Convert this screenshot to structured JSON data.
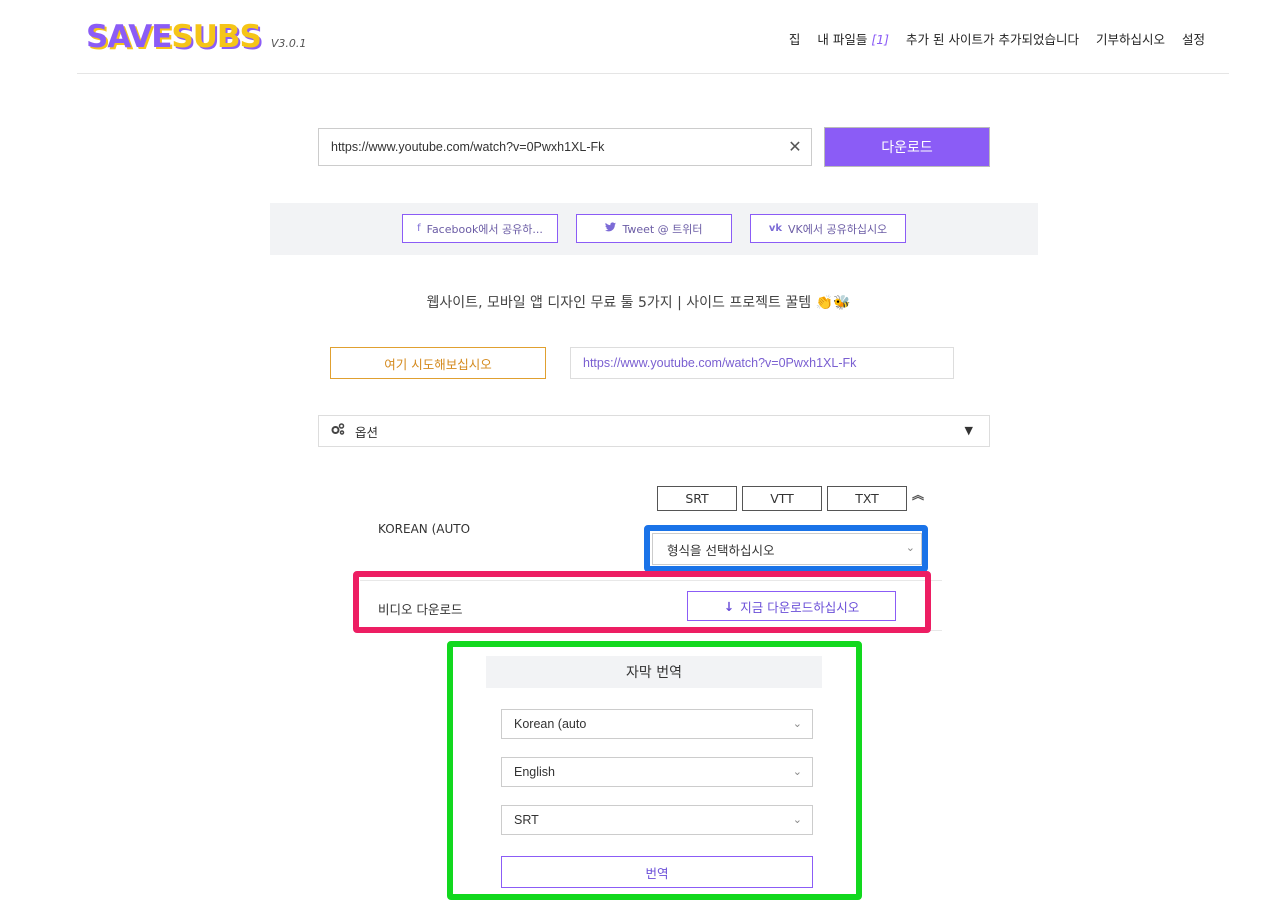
{
  "header": {
    "logo_prefix": "SAVE",
    "logo_suffix": "SUBS",
    "version": "V3.0.1",
    "nav": [
      {
        "label": "집"
      },
      {
        "label": "내 파일들",
        "count": "[1]"
      },
      {
        "label": "추가 된 사이트가 추가되었습니다"
      },
      {
        "label": "기부하십시오"
      },
      {
        "label": "설정"
      }
    ]
  },
  "search": {
    "url_value": "https://www.youtube.com/watch?v=0Pwxh1XL-Fk",
    "clear_glyph": "✕",
    "download_label": "다운로드"
  },
  "share": {
    "facebook": "Facebook에서 공유하...",
    "twitter": "Tweet @ 트위터",
    "vk": "VK에서 공유하십시오"
  },
  "tagline": "웹사이트, 모바일 앱 디자인 무료 툴 5가지 | 사이드 프로젝트 꿀템 👏🐝",
  "try": {
    "button_label": "여기 시도해보십시오",
    "example_url": "https://www.youtube.com/watch?v=0Pwxh1XL-Fk"
  },
  "options": {
    "label": "옵션"
  },
  "formats": [
    "SRT",
    "VTT",
    "TXT"
  ],
  "subtitle": {
    "language_label": "KOREAN (AUTO",
    "format_select": "형식을 선택하십시오"
  },
  "video": {
    "label": "비디오 다운로드",
    "button_label": "지금 다운로드하십시오"
  },
  "translate": {
    "heading": "자막 번역",
    "source_lang": "Korean (auto",
    "target_lang": "English",
    "format": "SRT",
    "button_label": "번역"
  },
  "colors": {
    "accent": "#8b5cf6",
    "highlight_blue": "#1a73e8",
    "highlight_pink": "#ed1e63",
    "highlight_green": "#12d81e"
  }
}
